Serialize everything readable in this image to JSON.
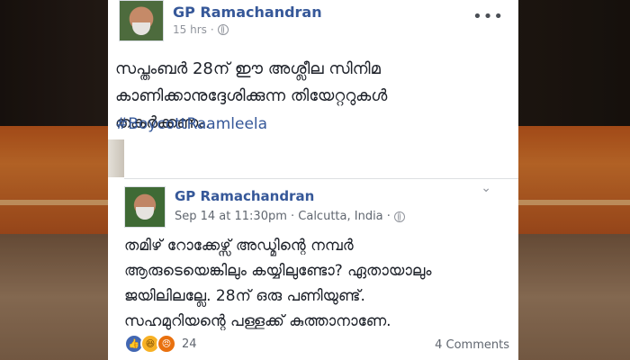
{
  "post": {
    "author": "GP Ramachandran",
    "time": "15 hrs",
    "more_label": "•••",
    "text_lines": [
      "സപ്തംബർ 28ന് ഈ അശ്ലീല സിനിമ",
      "കാണിക്കാനുദ്ദേശിക്കുന്ന തിയേറ്ററുകൾ",
      "തകർക്കണം."
    ],
    "hashtag": "#BoycottRaamleela"
  },
  "shared": {
    "author": "GP Ramachandran",
    "meta": "Sep 14 at 11:30pm · Calcutta, India ·",
    "text_lines": [
      "തമിഴ് റോക്കേഴ്സ് അഡ്മിന്റെ നമ്പർ",
      "ആരുടെയെങ്കിലും കയ്യിലുണ്ടോ? ഏതായാലും",
      "ജയിലിലല്ലേ. 28ന് ഒരു പണിയുണ്ട്.",
      "സഹമുറിയന്റെ പള്ളക്ക് കുത്താനാണേ."
    ],
    "reaction_count": "24",
    "comments_label": "4 Comments"
  },
  "icons": [
    "globe-icon",
    "more-icon",
    "chevron-down-icon",
    "like-reaction-icon",
    "haha-reaction-icon",
    "angry-reaction-icon"
  ],
  "colors": {
    "link": "#365899",
    "text": "#1d2129",
    "meta": "#90949c"
  }
}
